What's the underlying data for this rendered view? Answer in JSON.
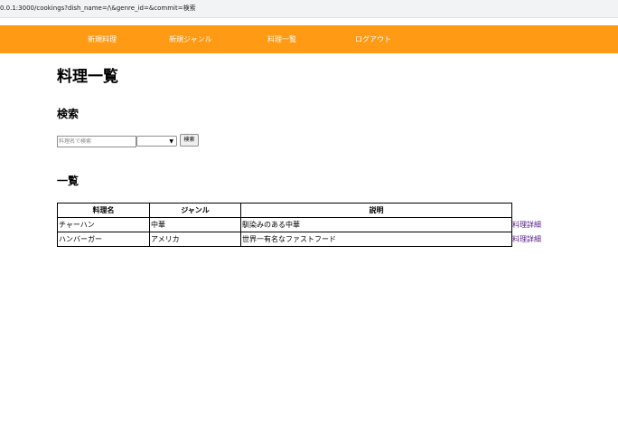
{
  "browser": {
    "url": "0.0.1:3000/cookings?dish_name=/\\&genre_id=&commit=検索"
  },
  "nav": {
    "items": [
      {
        "label": "新規料理"
      },
      {
        "label": "新規ジャンル"
      },
      {
        "label": "料理一覧"
      },
      {
        "label": "ログアウト"
      }
    ]
  },
  "page": {
    "title": "料理一覧",
    "search_heading": "検索",
    "list_heading": "一覧"
  },
  "search": {
    "placeholder": "料理名で検索",
    "genre_selected": "",
    "button_label": "検索"
  },
  "table": {
    "headers": [
      "料理名",
      "ジャンル",
      "説明"
    ],
    "rows": [
      {
        "name": "チャーハン",
        "genre": "中華",
        "description": "馴染みのある中華",
        "link": "料理詳細"
      },
      {
        "name": "ハンバーガー",
        "genre": "アメリカ",
        "description": "世界一有名なファストフード",
        "link": "料理詳細"
      }
    ]
  },
  "colors": {
    "navbar": "#ff9a14",
    "nav_text": "#ffffff",
    "visited_link": "#551a8b"
  }
}
